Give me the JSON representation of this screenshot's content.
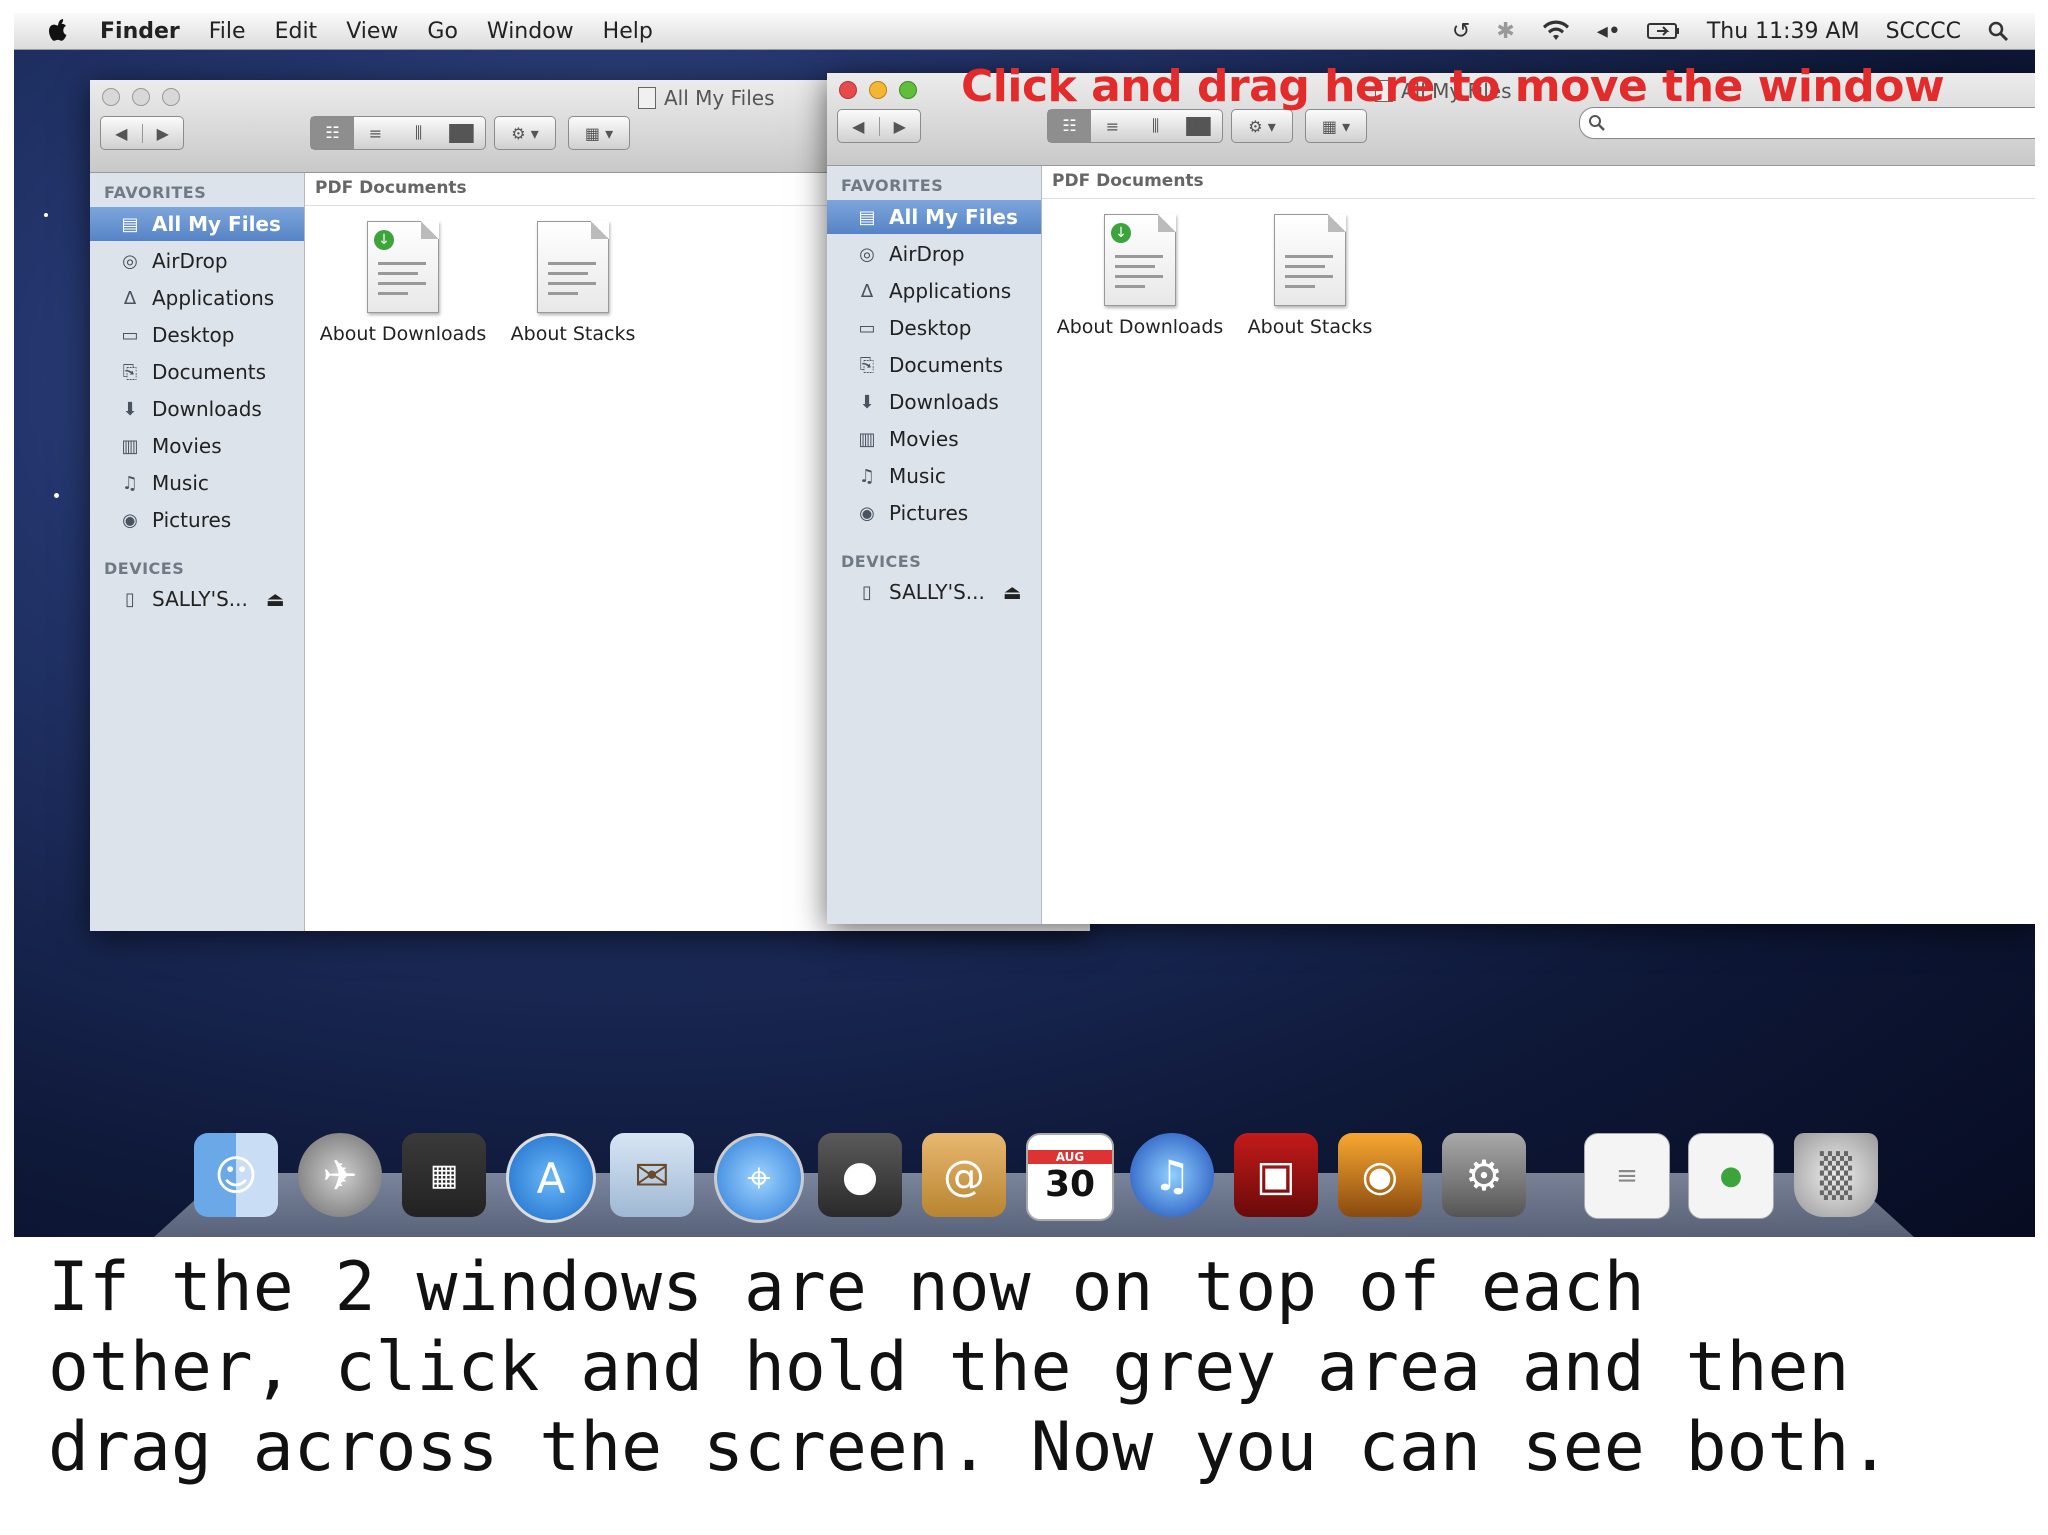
{
  "menubar": {
    "app": "Finder",
    "items": [
      "File",
      "Edit",
      "View",
      "Go",
      "Window",
      "Help"
    ],
    "clock": "Thu 11:39 AM",
    "user": "SCCCC"
  },
  "annotation": "Click and drag here to move the window",
  "window_back": {
    "title": "All My Files",
    "path": "PDF Documents",
    "favorites_header": "FAVORITES",
    "devices_header": "DEVICES",
    "favorites": [
      {
        "label": "All My Files",
        "icon": "all-files-icon"
      },
      {
        "label": "AirDrop",
        "icon": "airdrop-icon"
      },
      {
        "label": "Applications",
        "icon": "applications-icon"
      },
      {
        "label": "Desktop",
        "icon": "desktop-icon"
      },
      {
        "label": "Documents",
        "icon": "documents-icon"
      },
      {
        "label": "Downloads",
        "icon": "downloads-icon"
      },
      {
        "label": "Movies",
        "icon": "movies-icon"
      },
      {
        "label": "Music",
        "icon": "music-icon"
      },
      {
        "label": "Pictures",
        "icon": "pictures-icon"
      }
    ],
    "devices": [
      {
        "label": "SALLY'S...",
        "icon": "disk-icon"
      }
    ],
    "files": [
      "About Downloads",
      "About Stacks"
    ]
  },
  "window_front": {
    "title": "All My Files",
    "path": "PDF Documents",
    "favorites_header": "FAVORITES",
    "devices_header": "DEVICES",
    "favorites": [
      {
        "label": "All My Files",
        "icon": "all-files-icon"
      },
      {
        "label": "AirDrop",
        "icon": "airdrop-icon"
      },
      {
        "label": "Applications",
        "icon": "applications-icon"
      },
      {
        "label": "Desktop",
        "icon": "desktop-icon"
      },
      {
        "label": "Documents",
        "icon": "documents-icon"
      },
      {
        "label": "Downloads",
        "icon": "downloads-icon"
      },
      {
        "label": "Movies",
        "icon": "movies-icon"
      },
      {
        "label": "Music",
        "icon": "music-icon"
      },
      {
        "label": "Pictures",
        "icon": "pictures-icon"
      }
    ],
    "devices": [
      {
        "label": "SALLY'S...",
        "icon": "disk-icon"
      }
    ],
    "files": [
      "About Downloads",
      "About Stacks"
    ]
  },
  "dock": {
    "calendar_month": "AUG",
    "calendar_day": "30",
    "icons": [
      "finder-icon",
      "launchpad-icon",
      "mission-control-icon",
      "app-store-icon",
      "mail-icon",
      "safari-icon",
      "facetime-icon",
      "address-book-icon",
      "ical-icon",
      "itunes-icon",
      "photo-booth-icon",
      "iphoto-icon",
      "system-preferences-icon",
      "pdf-document-icon",
      "pdf-document-icon",
      "trash-icon"
    ]
  },
  "caption": "If the 2 windows are now on top of each\nother, click and hold the grey area and then\ndrag across the screen. Now you can see both.",
  "colors": {
    "annotation": "#e42b2b",
    "sidebar_selected": "#5583c6",
    "desktop": "#1a2a5c"
  }
}
